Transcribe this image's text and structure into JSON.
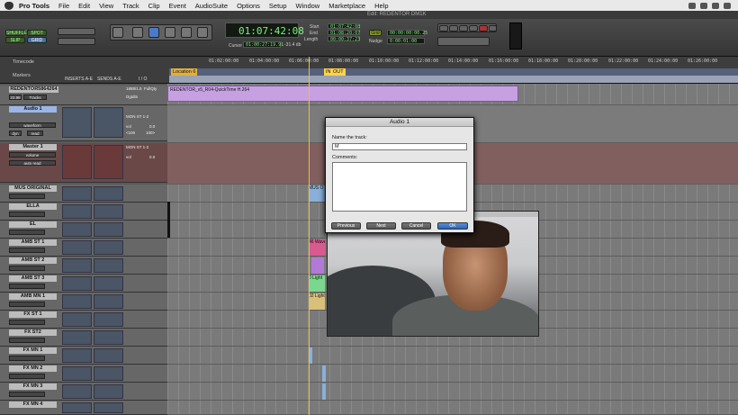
{
  "menubar": {
    "app": "Pro Tools",
    "items": [
      "File",
      "Edit",
      "View",
      "Track",
      "Clip",
      "Event",
      "AudioSuite",
      "Options",
      "Setup",
      "Window",
      "Marketplace",
      "Help"
    ]
  },
  "window": {
    "title": "Edit: REDENTOR DM1K"
  },
  "toolbar": {
    "mode_shuffle": "SHUFFLE",
    "mode_spot": "SPOT",
    "mode_slip": "SLIP",
    "mode_grid": "GRID",
    "main_counter": "01:07:42:08",
    "sub_counter_label": "Cursor",
    "sub_counter": "01:00:27:19.91",
    "sub_level": "-31.4 db",
    "start_label": "Start",
    "end_label": "End",
    "length_label": "Length",
    "start": "01:07:42:08",
    "end": "01:08:20:07",
    "length": "00:00:37:23",
    "grid_label": "Grid",
    "grid_value": "00:00:00:00.25",
    "nudge_label": "Nudge",
    "nudge_value": "0:00:01:00"
  },
  "rulers": {
    "timecode_label": "Timecode",
    "markers_label": "Markers",
    "ticks": [
      "01:02:00:00",
      "01:04:00:00",
      "01:06:00:00",
      "01:08:00:00",
      "01:10:00:00",
      "01:12:00:00",
      "01:14:00:00",
      "01:16:00:00",
      "01:18:00:00",
      "01:20:00:00",
      "01:22:00:00",
      "01:24:00:00",
      "01:26:00:00",
      "01:28:00:00"
    ],
    "location": "Location 6",
    "in": "IN",
    "out": "OUT"
  },
  "columns": {
    "inserts": "INSERTS A-E",
    "sends": "SENDS A-E",
    "io": "I / O"
  },
  "video_track": {
    "name": "REDENTOR5864264",
    "fps": "23.98",
    "button": "Tracks",
    "io_a": "1888/1.5",
    "io_b": "FullQty",
    "io_c": "Dgtdtn",
    "clip": "REDENTOR_v5_R04-QuickTime H.264"
  },
  "tracks": [
    {
      "name": "Audio 1",
      "color": "#8ba6d6"
    },
    {
      "name": "Master 1",
      "color": "#b05555"
    },
    {
      "name": "MUS ORIGINAL",
      "color": "#6a9a8a"
    },
    {
      "name": "ELLA",
      "color": "#6a9a8a"
    },
    {
      "name": "EL",
      "color": "#6a9a8a"
    },
    {
      "name": "AMB ST 1",
      "color": "#6a9a8a"
    },
    {
      "name": "AMB ST 2",
      "color": "#6a9a8a"
    },
    {
      "name": "AMB ST 3",
      "color": "#6a9a8a"
    },
    {
      "name": "AMB MN 1",
      "color": "#6a9a8a"
    },
    {
      "name": "FX ST 1",
      "color": "#6a9a8a"
    },
    {
      "name": "FX ST2",
      "color": "#6a9a8a"
    },
    {
      "name": "FX MN 1",
      "color": "#6a9a8a"
    },
    {
      "name": "FX MN 2",
      "color": "#6a9a8a"
    },
    {
      "name": "FX MN 3",
      "color": "#6a9a8a"
    },
    {
      "name": "FX MN 4",
      "color": "#6a9a8a"
    }
  ],
  "audio1": {
    "view": "waveform",
    "io": "MON ST 1-2",
    "dyn": "dyn",
    "mode": "read",
    "vol": "vol",
    "vol_val": "0.0",
    "pan_l": "<100",
    "pan_r": "100>"
  },
  "master1": {
    "view": "volume",
    "io": "MON ST 1-2",
    "mode": "auto read",
    "vol": "vol",
    "vol_val": "0.0"
  },
  "clips": [
    "MUS O",
    "46 Wave",
    "0 Light",
    "02 Light"
  ],
  "dialog": {
    "title": "Audio 1",
    "name_label": "Name the track:",
    "name_value": "M",
    "comments_label": "Comments:",
    "previous": "Previous",
    "next": "Next",
    "cancel": "Cancel",
    "ok": "OK"
  }
}
